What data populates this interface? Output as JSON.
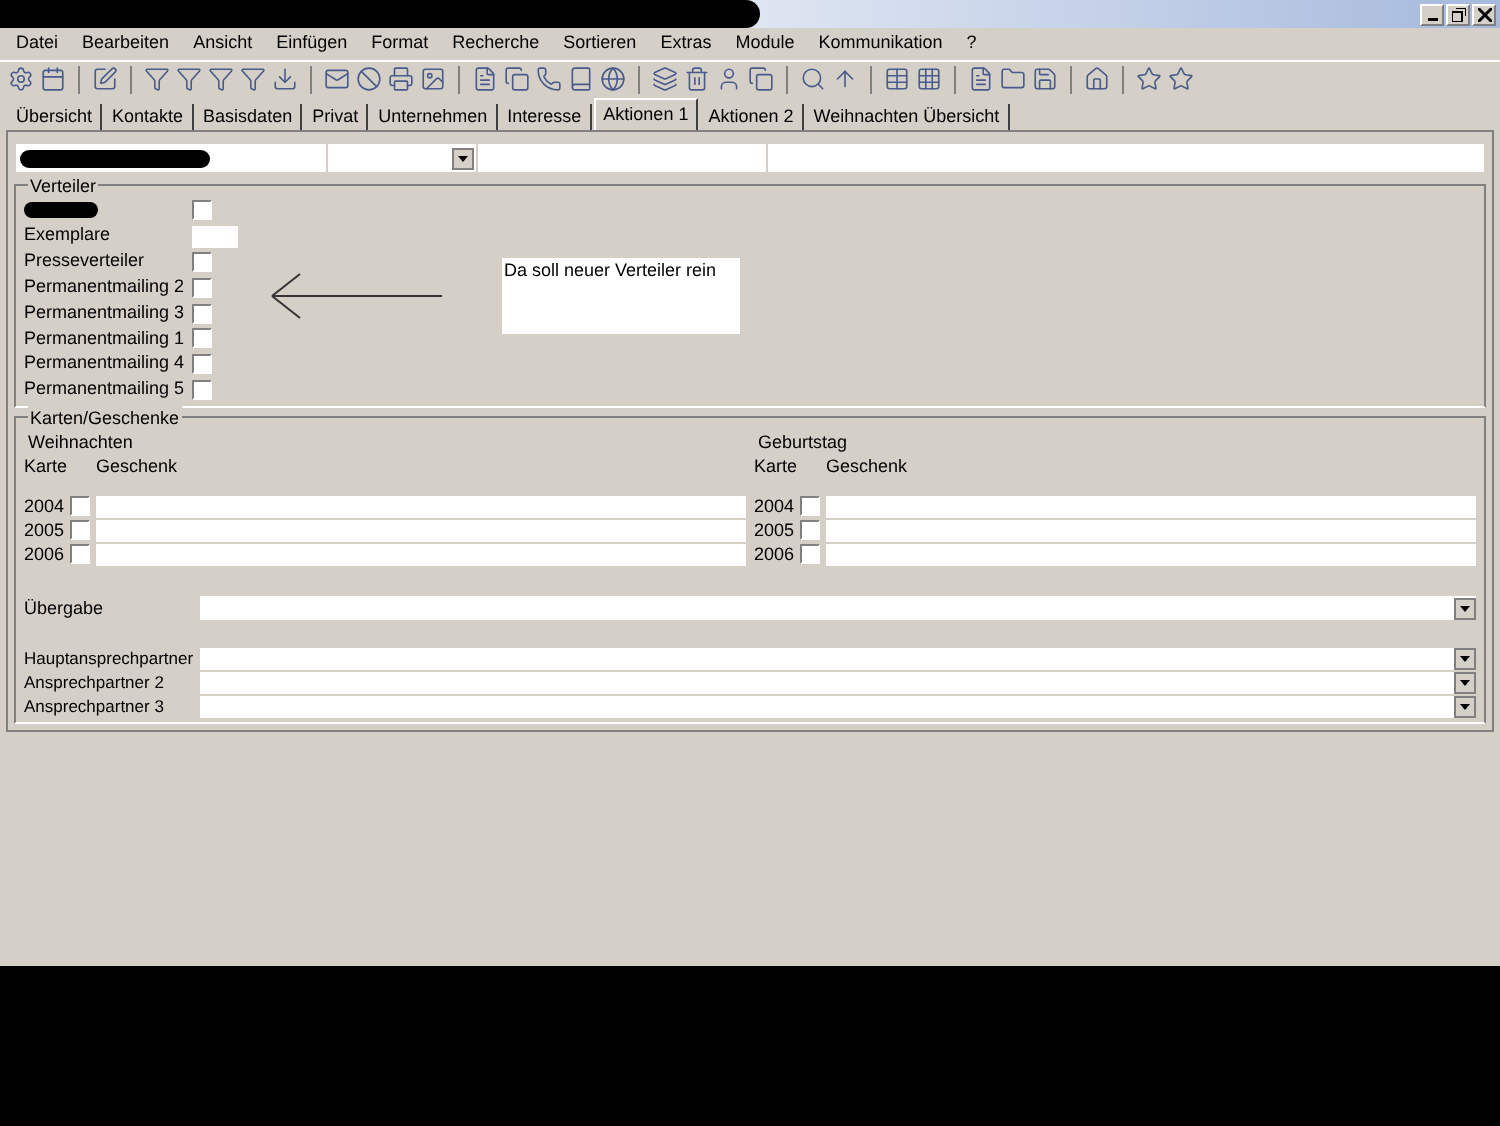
{
  "menu": [
    "Datei",
    "Bearbeiten",
    "Ansicht",
    "Einfügen",
    "Format",
    "Recherche",
    "Sortieren",
    "Extras",
    "Module",
    "Kommunikation",
    "?"
  ],
  "tabs": [
    {
      "label": "Übersicht",
      "selected": false
    },
    {
      "label": "Kontakte",
      "selected": false
    },
    {
      "label": "Basisdaten",
      "selected": false
    },
    {
      "label": "Privat",
      "selected": false
    },
    {
      "label": "Unternehmen",
      "selected": false
    },
    {
      "label": "Interesse",
      "selected": false
    },
    {
      "label": "Aktionen 1",
      "selected": true
    },
    {
      "label": "Aktionen 2",
      "selected": false
    },
    {
      "label": "Weihnachten Übersicht",
      "selected": false
    }
  ],
  "verteiler": {
    "title": "Verteiler",
    "rows": [
      {
        "kind": "redacted",
        "checked": false
      },
      {
        "kind": "field",
        "label": "Exemplare"
      },
      {
        "kind": "checkbox",
        "label": "Presseverteiler",
        "checked": false
      },
      {
        "kind": "checkbox",
        "label": "Permanentmailing 2",
        "checked": false
      },
      {
        "kind": "checkbox",
        "label": "Permanentmailing 3",
        "checked": false
      },
      {
        "kind": "checkbox",
        "label": "Permanentmailing 1",
        "checked": false
      },
      {
        "kind": "checkbox",
        "label": "Permanentmailing 4",
        "checked": false
      },
      {
        "kind": "checkbox",
        "label": "Permanentmailing 5",
        "checked": false
      }
    ]
  },
  "note": "Da soll neuer Verteiler rein",
  "karten": {
    "title": "Karten/Geschenke",
    "groups": [
      {
        "title": "Weihnachten",
        "karte": "Karte",
        "geschenk": "Geschenk",
        "rows": [
          {
            "year": "2004",
            "checked": false
          },
          {
            "year": "2005",
            "checked": false
          },
          {
            "year": "2006",
            "checked": false
          }
        ]
      },
      {
        "title": "Geburtstag",
        "karte": "Karte",
        "geschenk": "Geschenk",
        "rows": [
          {
            "year": "2004",
            "checked": false
          },
          {
            "year": "2005",
            "checked": false
          },
          {
            "year": "2006",
            "checked": false
          }
        ]
      }
    ],
    "uebergabe": "Übergabe",
    "contacts": [
      "Hauptansprechpartner",
      "Ansprechpartner 2",
      "Ansprechpartner 3"
    ]
  }
}
